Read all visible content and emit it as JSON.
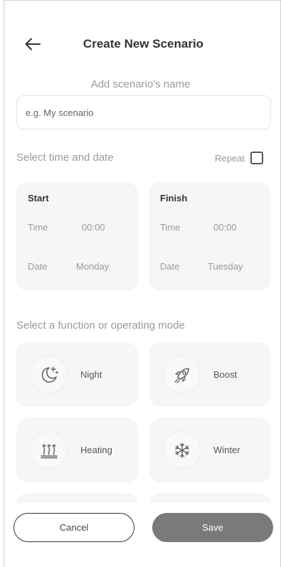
{
  "header": {
    "title": "Create New Scenario"
  },
  "name_section": {
    "label": "Add scenario's name",
    "placeholder": "e.g. My scenario",
    "value": ""
  },
  "schedule": {
    "label": "Select time and date",
    "repeat_label": "Repeat",
    "repeat_checked": false,
    "start": {
      "title": "Start",
      "time_label": "Time",
      "time_value": "00:00",
      "date_label": "Date",
      "date_value": "Monday"
    },
    "finish": {
      "title": "Finish",
      "time_label": "Time",
      "time_value": "00:00",
      "date_label": "Date",
      "date_value": "Tuesday"
    }
  },
  "modes": {
    "label": "Select a function or operating mode",
    "items": [
      {
        "label": "Night",
        "icon": "moon-stars-icon"
      },
      {
        "label": "Boost",
        "icon": "rocket-icon"
      },
      {
        "label": "Heating",
        "icon": "heating-icon"
      },
      {
        "label": "Winter",
        "icon": "snowflake-icon"
      },
      {
        "label": "",
        "icon": ""
      },
      {
        "label": "",
        "icon": ""
      }
    ]
  },
  "footer": {
    "cancel_label": "Cancel",
    "save_label": "Save"
  },
  "colors": {
    "card_bg": "#f6f6f6",
    "muted_text": "#9a9a9a",
    "save_button": "#7a7a7a"
  }
}
